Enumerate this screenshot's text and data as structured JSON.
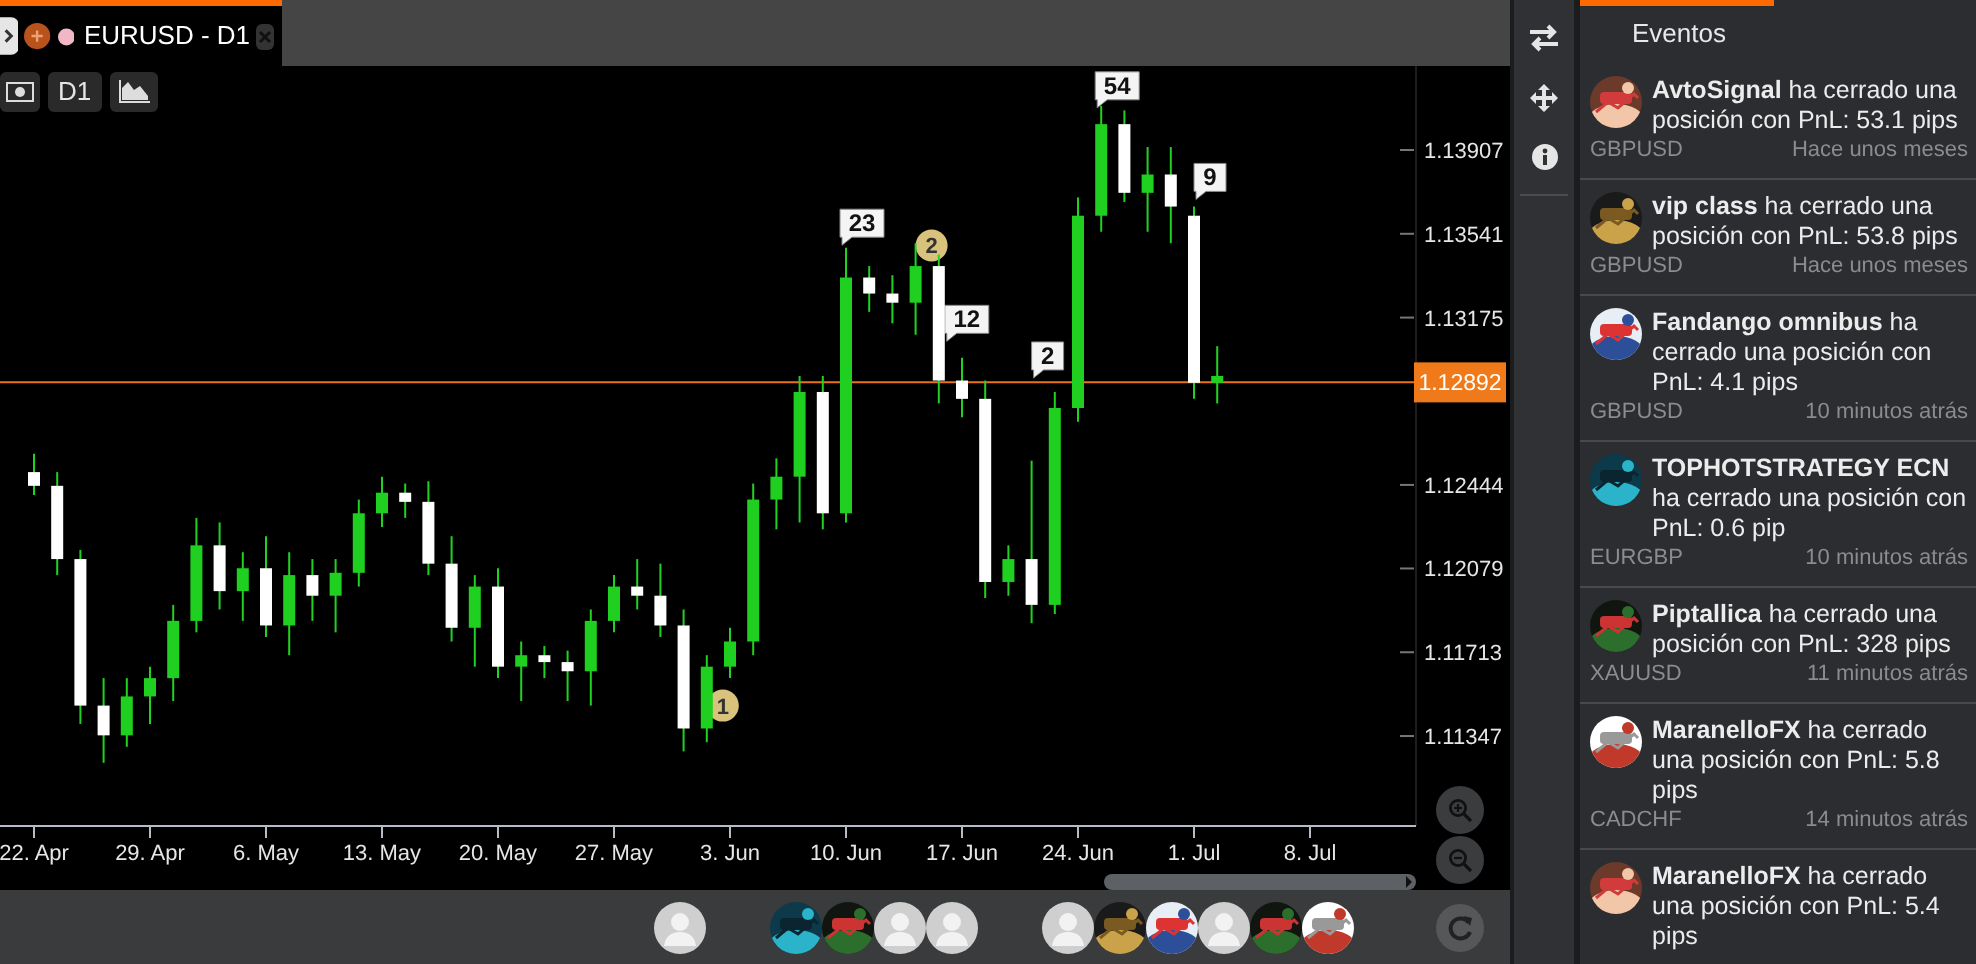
{
  "tabs": [
    {
      "title": "EURUSD - D1",
      "selected": true
    }
  ],
  "chart_toolbar": {
    "timeframe": "D1"
  },
  "chart": {
    "chart_data": {
      "type": "candlestick",
      "categories": [
        "22. Apr",
        null,
        null,
        null,
        null,
        "29. Apr",
        null,
        null,
        null,
        null,
        "6. May",
        null,
        null,
        null,
        null,
        "13. May",
        null,
        null,
        null,
        null,
        "20. May",
        null,
        null,
        null,
        null,
        "27. May",
        null,
        null,
        null,
        null,
        "3. Jun",
        null,
        null,
        null,
        null,
        "10. Jun",
        null,
        null,
        null,
        null,
        "17. Jun",
        null,
        null,
        null,
        null,
        "24. Jun",
        null,
        null,
        null,
        null,
        "1. Jul",
        null,
        null,
        null,
        null,
        "8. Jul"
      ],
      "ohlc": [
        [
          1.125,
          1.1258,
          1.124,
          1.1244
        ],
        [
          1.1244,
          1.125,
          1.1205,
          1.1212
        ],
        [
          1.1212,
          1.1216,
          1.114,
          1.1148
        ],
        [
          1.1148,
          1.116,
          1.1123,
          1.1135
        ],
        [
          1.1135,
          1.116,
          1.113,
          1.1152
        ],
        [
          1.1152,
          1.1165,
          1.114,
          1.116
        ],
        [
          1.116,
          1.1192,
          1.115,
          1.1185
        ],
        [
          1.1185,
          1.123,
          1.118,
          1.1218
        ],
        [
          1.1218,
          1.1228,
          1.119,
          1.1198
        ],
        [
          1.1198,
          1.1215,
          1.1185,
          1.1208
        ],
        [
          1.1208,
          1.1222,
          1.1178,
          1.1183
        ],
        [
          1.1183,
          1.1215,
          1.117,
          1.1205
        ],
        [
          1.1205,
          1.1212,
          1.1185,
          1.1196
        ],
        [
          1.1196,
          1.1212,
          1.118,
          1.1206
        ],
        [
          1.1206,
          1.1238,
          1.12,
          1.1232
        ],
        [
          1.1232,
          1.1248,
          1.1226,
          1.1241
        ],
        [
          1.1241,
          1.1245,
          1.123,
          1.1237
        ],
        [
          1.1237,
          1.1246,
          1.1205,
          1.121
        ],
        [
          1.121,
          1.1222,
          1.1176,
          1.1182
        ],
        [
          1.1182,
          1.1205,
          1.1165,
          1.12
        ],
        [
          1.12,
          1.1208,
          1.116,
          1.1165
        ],
        [
          1.1165,
          1.1176,
          1.115,
          1.117
        ],
        [
          1.117,
          1.1174,
          1.116,
          1.1167
        ],
        [
          1.1167,
          1.1172,
          1.115,
          1.1163
        ],
        [
          1.1163,
          1.119,
          1.1148,
          1.1185
        ],
        [
          1.1185,
          1.1205,
          1.118,
          1.12
        ],
        [
          1.12,
          1.1212,
          1.119,
          1.1196
        ],
        [
          1.1196,
          1.121,
          1.1178,
          1.1183
        ],
        [
          1.1183,
          1.119,
          1.1128,
          1.1138
        ],
        [
          1.1138,
          1.117,
          1.1132,
          1.1165
        ],
        [
          1.1165,
          1.1182,
          1.116,
          1.1176
        ],
        [
          1.1176,
          1.1245,
          1.117,
          1.1238
        ],
        [
          1.1238,
          1.1256,
          1.1225,
          1.1248
        ],
        [
          1.1248,
          1.1292,
          1.1228,
          1.1285
        ],
        [
          1.1285,
          1.1292,
          1.1225,
          1.1232
        ],
        [
          1.1232,
          1.1348,
          1.1228,
          1.1335
        ],
        [
          1.1335,
          1.134,
          1.132,
          1.1328
        ],
        [
          1.1328,
          1.1336,
          1.1315,
          1.1324
        ],
        [
          1.1324,
          1.135,
          1.131,
          1.134
        ],
        [
          1.134,
          1.1345,
          1.128,
          1.129
        ],
        [
          1.129,
          1.13,
          1.1274,
          1.1282
        ],
        [
          1.1282,
          1.129,
          1.1195,
          1.1202
        ],
        [
          1.1202,
          1.1218,
          1.1196,
          1.1212
        ],
        [
          1.1212,
          1.1255,
          1.1184,
          1.1192
        ],
        [
          1.1192,
          1.1285,
          1.1188,
          1.1278
        ],
        [
          1.1278,
          1.137,
          1.1272,
          1.1362
        ],
        [
          1.1362,
          1.141,
          1.1355,
          1.1402
        ],
        [
          1.1402,
          1.1408,
          1.1368,
          1.1372
        ],
        [
          1.1372,
          1.1392,
          1.1355,
          1.138
        ],
        [
          1.138,
          1.1392,
          1.135,
          1.1366
        ],
        [
          1.1362,
          1.1366,
          1.1282,
          1.1289
        ],
        [
          1.1289,
          1.1305,
          1.128,
          1.1292
        ],
        null,
        null,
        null,
        null
      ],
      "yticks": [
        {
          "value": 1.13907,
          "label": "1.13907"
        },
        {
          "value": 1.13541,
          "label": "1.13541"
        },
        {
          "value": 1.13175,
          "label": "1.13175"
        },
        {
          "value": 1.12444,
          "label": "1.12444"
        },
        {
          "value": 1.12079,
          "label": "1.12079"
        },
        {
          "value": 1.11713,
          "label": "1.11713"
        },
        {
          "value": 1.11347,
          "label": "1.11347"
        }
      ],
      "ylim": [
        1.10954,
        1.14274
      ],
      "ref_lines": [
        {
          "axis": "y",
          "value": 1.12892,
          "label": "1.12892"
        }
      ],
      "annotations": [
        "54",
        "9",
        "23",
        "2",
        "12",
        "2",
        "1"
      ]
    }
  },
  "bottom_bar": {
    "groups": [
      [
        {
          "kind": "silhouette"
        }
      ],
      [
        {
          "kind": "picture"
        },
        {
          "kind": "picture"
        },
        {
          "kind": "silhouette"
        },
        {
          "kind": "silhouette"
        }
      ],
      [
        {
          "kind": "silhouette"
        },
        {
          "kind": "picture"
        },
        {
          "kind": "picture"
        },
        {
          "kind": "silhouette"
        },
        {
          "kind": "picture"
        },
        {
          "kind": "picture"
        }
      ]
    ]
  },
  "events_panel": {
    "tab": {
      "title": "Eventos",
      "selected": true
    },
    "items": [
      {
        "message": "**AvtoSignal** ha cerrado una posición con PnL: 53.1 pips",
        "symbol": "GBPUSD",
        "time": "Hace unos meses"
      },
      {
        "message": "**vip class** ha cerrado una posición con PnL: 53.8 pips",
        "symbol": "GBPUSD",
        "time": "Hace unos meses"
      },
      {
        "message": "**Fandango omnibus** ha cerrado una posición con PnL: 4.1 pips",
        "symbol": "GBPUSD",
        "time": "10 minutos atrás"
      },
      {
        "message": "**TOPHOTSTRATEGY ECN** ha cerrado una posición con PnL: 0.6 pip",
        "symbol": "EURGBP",
        "time": "10 minutos atrás"
      },
      {
        "message": "**Piptallica** ha cerrado una posición con PnL: 328 pips",
        "symbol": "XAUUSD",
        "time": "11 minutos atrás"
      },
      {
        "message": "**MaranelloFX** ha cerrado una posición con PnL: 5.8 pips",
        "symbol": "CADCHF",
        "time": "14 minutos atrás"
      },
      {
        "message": "**MaranelloFX** ha cerrado una posición con PnL: 5.4 pips"
      }
    ]
  }
}
